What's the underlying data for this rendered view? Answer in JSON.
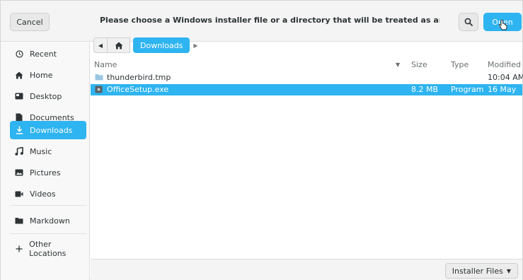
{
  "header": {
    "cancel_label": "Cancel",
    "title": "Please choose a Windows installer file or a directory that will be treated as an installation volume",
    "open_label": "Open",
    "search_icon": "search-icon"
  },
  "sidebar": {
    "items": [
      {
        "label": "Recent",
        "icon": "clock-icon"
      },
      {
        "label": "Home",
        "icon": "home-icon"
      },
      {
        "label": "Desktop",
        "icon": "desktop-icon"
      },
      {
        "label": "Documents",
        "icon": "document-icon"
      },
      {
        "label": "Downloads",
        "icon": "download-icon",
        "active": true
      },
      {
        "label": "Music",
        "icon": "music-icon"
      },
      {
        "label": "Pictures",
        "icon": "pictures-icon"
      },
      {
        "label": "Videos",
        "icon": "video-icon"
      },
      {
        "label": "Markdown",
        "icon": "folder-icon"
      },
      {
        "label": "Other Locations",
        "icon": "plus-icon"
      }
    ]
  },
  "pathbar": {
    "current": "Downloads"
  },
  "file_list": {
    "columns": {
      "name": "Name",
      "size": "Size",
      "type": "Type",
      "modified": "Modified"
    },
    "rows": [
      {
        "name": "thunderbird.tmp",
        "size": "",
        "type": "",
        "modified": "10:04 AM",
        "icon": "folder-icon"
      },
      {
        "name": "OfficeSetup.exe",
        "size": "8.2 MB",
        "type": "Program",
        "modified": "16 May",
        "icon": "executable-icon",
        "selected": true
      }
    ]
  },
  "footer": {
    "filter_label": "Installer Files"
  },
  "colors": {
    "accent": "#2eb4f0",
    "background": "#ffffff",
    "sidebar_bg": "#f8f8f8"
  }
}
